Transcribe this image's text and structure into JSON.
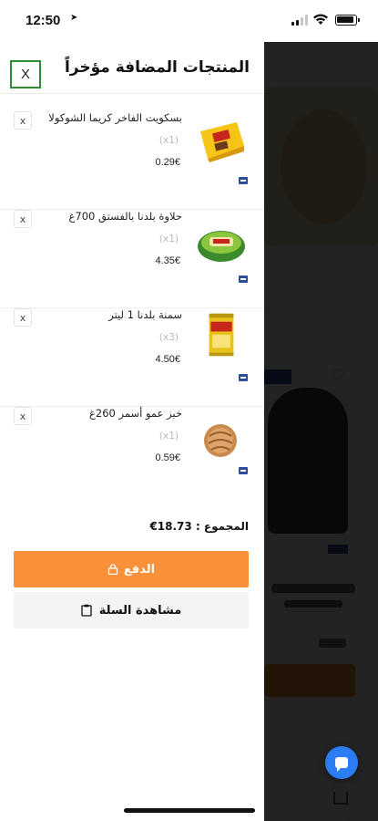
{
  "status_bar": {
    "time": "12:50"
  },
  "drawer": {
    "title": "المنتجات المضافة مؤخراً",
    "close_label": "X",
    "items": [
      {
        "name": "بسكويت الفاخر كريما الشوكولا",
        "qty": "(x1)",
        "price": "0.29€",
        "remove": "x"
      },
      {
        "name": "حلاوة بلدنا بالفستق 700غ",
        "qty": "(x1)",
        "price": "4.35€",
        "remove": "x"
      },
      {
        "name": "سمنة بلدنا 1 ليتر",
        "qty": "(x3)",
        "price": "4.50€",
        "remove": "x"
      },
      {
        "name": "خبز عمو أسمر 260غ",
        "qty": "(x1)",
        "price": "0.59€",
        "remove": "x"
      }
    ],
    "total_text": "المجموع : 18.73€",
    "pay_label": "الدفع",
    "view_cart_label": "مشاهدة السلة"
  },
  "background": {
    "price": "9.99€"
  },
  "colors": {
    "accent": "#f8913a",
    "close_border": "#2e8b2e",
    "chat": "#2c7cf6"
  }
}
